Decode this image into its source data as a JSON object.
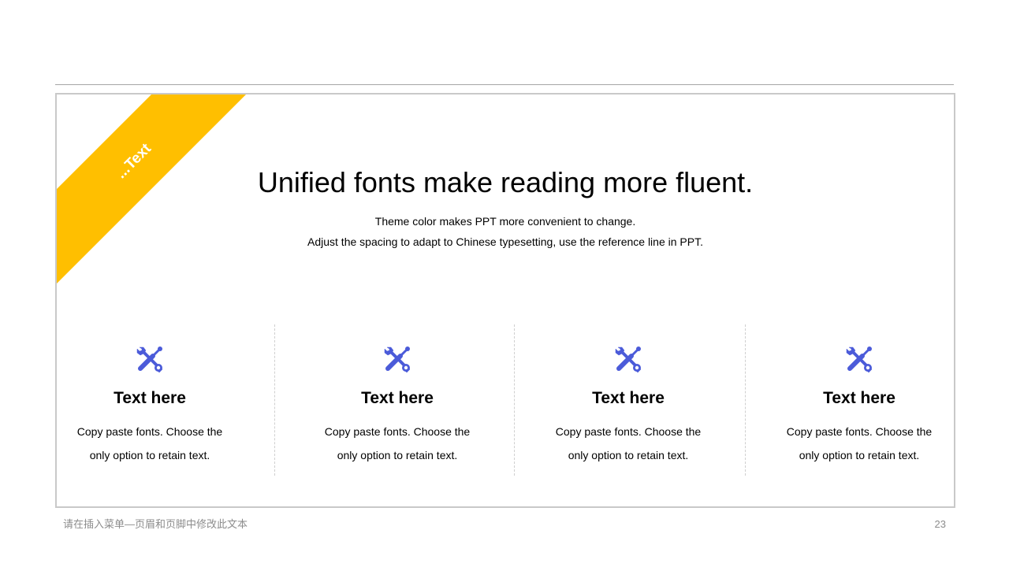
{
  "colors": {
    "accent": "#FFBF00",
    "icon": "#4B5BD9",
    "frame": "#C9C9C9",
    "footer_text": "#8C8C8C"
  },
  "ribbon": {
    "label": "...Text"
  },
  "heading": {
    "title": "Unified fonts make reading more fluent.",
    "subtitle_line1": "Theme color makes PPT more convenient to change.",
    "subtitle_line2": "Adjust the spacing to adapt to Chinese typesetting, use the reference line in PPT."
  },
  "columns": [
    {
      "icon": "tools-icon",
      "title": "Text here",
      "body_line1": "Copy paste fonts. Choose the",
      "body_line2": "only option to retain text."
    },
    {
      "icon": "tools-icon",
      "title": "Text here",
      "body_line1": "Copy paste fonts. Choose the",
      "body_line2": "only option to retain text."
    },
    {
      "icon": "tools-icon",
      "title": "Text here",
      "body_line1": "Copy paste fonts. Choose the",
      "body_line2": "only option to retain text."
    },
    {
      "icon": "tools-icon",
      "title": "Text here",
      "body_line1": "Copy paste fonts. Choose the",
      "body_line2": "only option to retain text."
    }
  ],
  "footer": {
    "left_text": "请在插入菜单—页眉和页脚中修改此文本",
    "page_number": "23"
  }
}
